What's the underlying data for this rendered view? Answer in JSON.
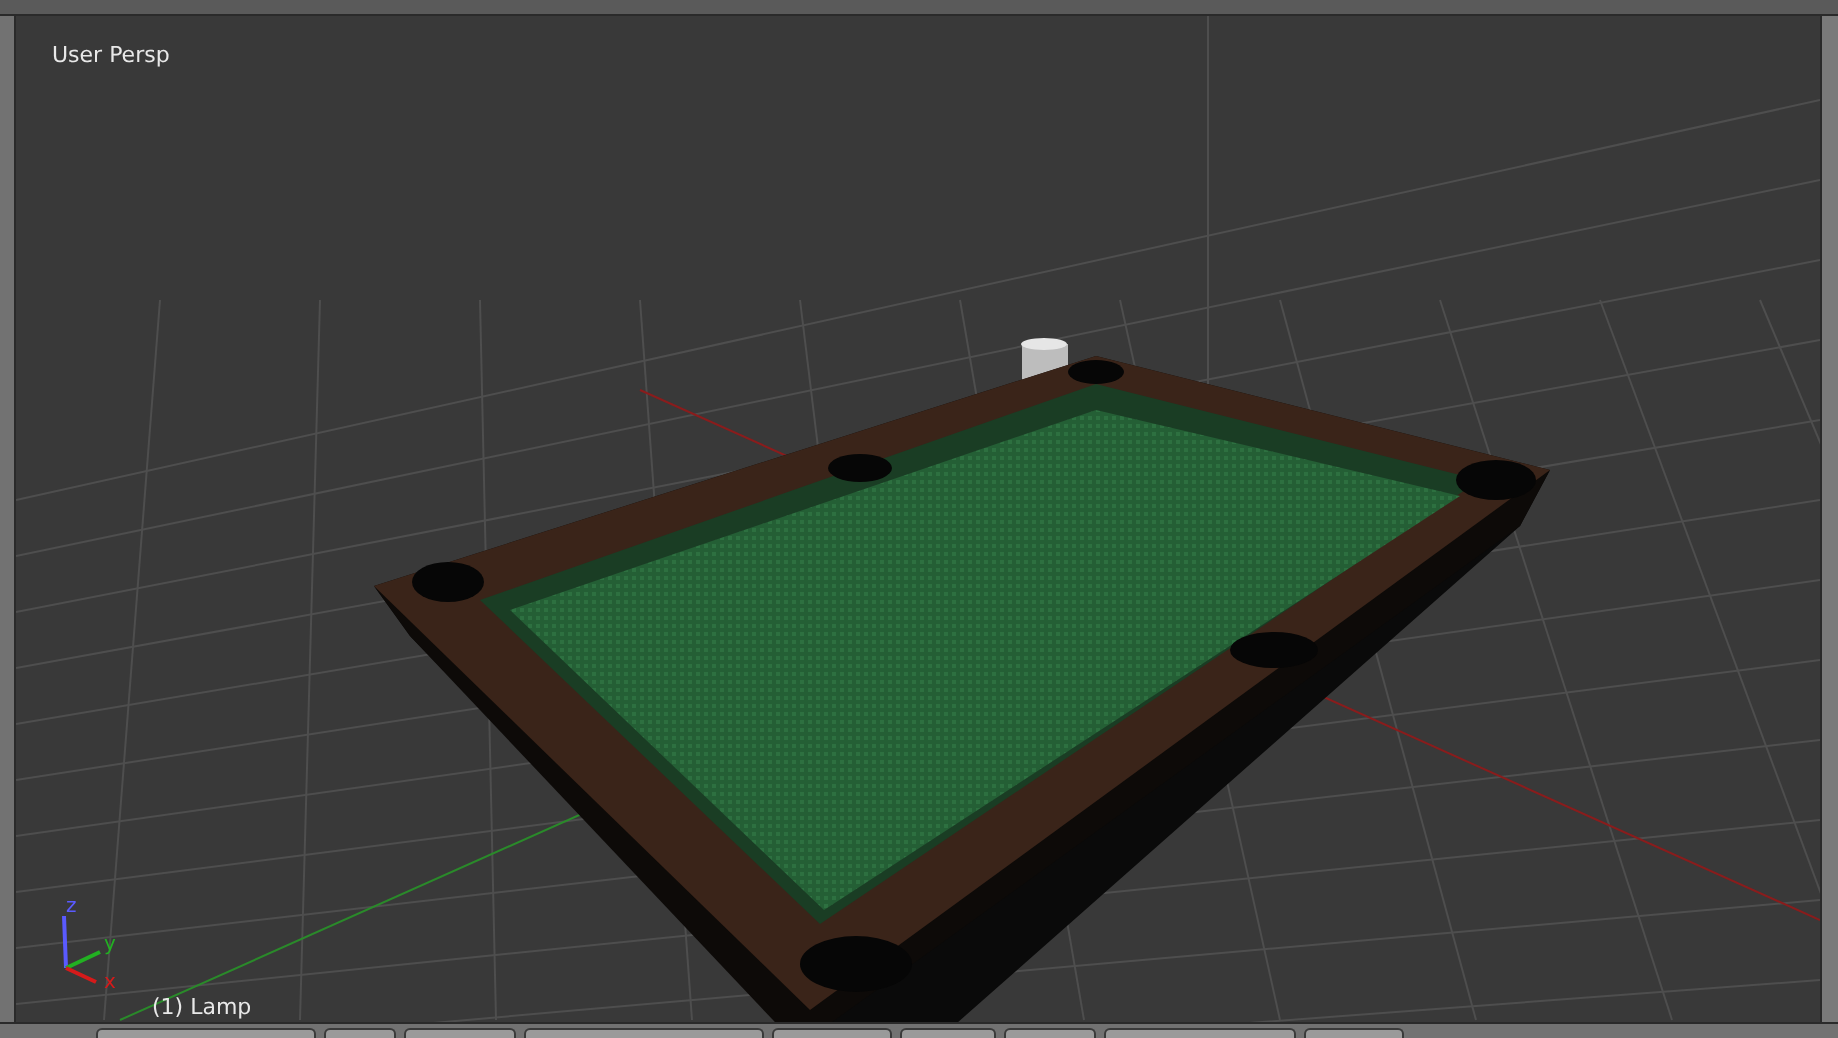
{
  "viewport": {
    "title": "User Persp",
    "active_object": "(1) Lamp"
  },
  "axes": [
    {
      "label": "z",
      "color": "#5a5aff"
    },
    {
      "label": "y",
      "color": "#22b022"
    },
    {
      "label": "x",
      "color": "#d61a1a"
    }
  ]
}
